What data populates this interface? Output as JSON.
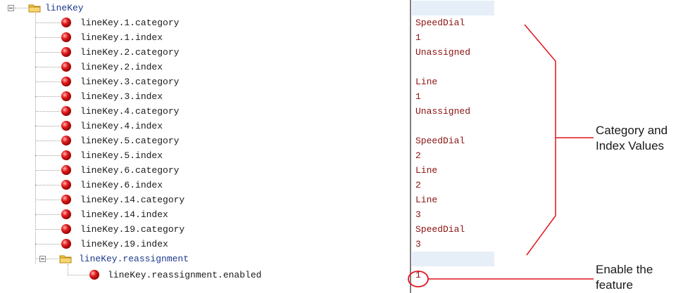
{
  "tree": {
    "root": {
      "label": "lineKey",
      "icon": "folder-icon"
    },
    "items": [
      {
        "key": "lineKey.1.category",
        "value": "SpeedDial"
      },
      {
        "key": "lineKey.1.index",
        "value": "1"
      },
      {
        "key": "lineKey.2.category",
        "value": "Unassigned"
      },
      {
        "key": "lineKey.2.index",
        "value": ""
      },
      {
        "key": "lineKey.3.category",
        "value": "Line"
      },
      {
        "key": "lineKey.3.index",
        "value": "1"
      },
      {
        "key": "lineKey.4.category",
        "value": "Unassigned"
      },
      {
        "key": "lineKey.4.index",
        "value": ""
      },
      {
        "key": "lineKey.5.category",
        "value": "SpeedDial"
      },
      {
        "key": "lineKey.5.index",
        "value": "2"
      },
      {
        "key": "lineKey.6.category",
        "value": "Line"
      },
      {
        "key": "lineKey.6.index",
        "value": "2"
      },
      {
        "key": "lineKey.14.category",
        "value": "Line"
      },
      {
        "key": "lineKey.14.index",
        "value": "3"
      },
      {
        "key": "lineKey.19.category",
        "value": "SpeedDial"
      },
      {
        "key": "lineKey.19.index",
        "value": "3"
      }
    ],
    "subfolder": {
      "label": "lineKey.reassignment",
      "icon": "folder-icon"
    },
    "subitem": {
      "key": "lineKey.reassignment.enabled",
      "value": "1"
    }
  },
  "annotations": {
    "category_index": {
      "line1": "Category and",
      "line2": "Index Values"
    },
    "enable": {
      "line1": "Enable the",
      "line2": "feature"
    }
  },
  "colors": {
    "annotation_red": "#e0141e",
    "value_text": "#8b1010",
    "value_band": "#e6eef7",
    "folder_text": "#1c3a8c"
  }
}
